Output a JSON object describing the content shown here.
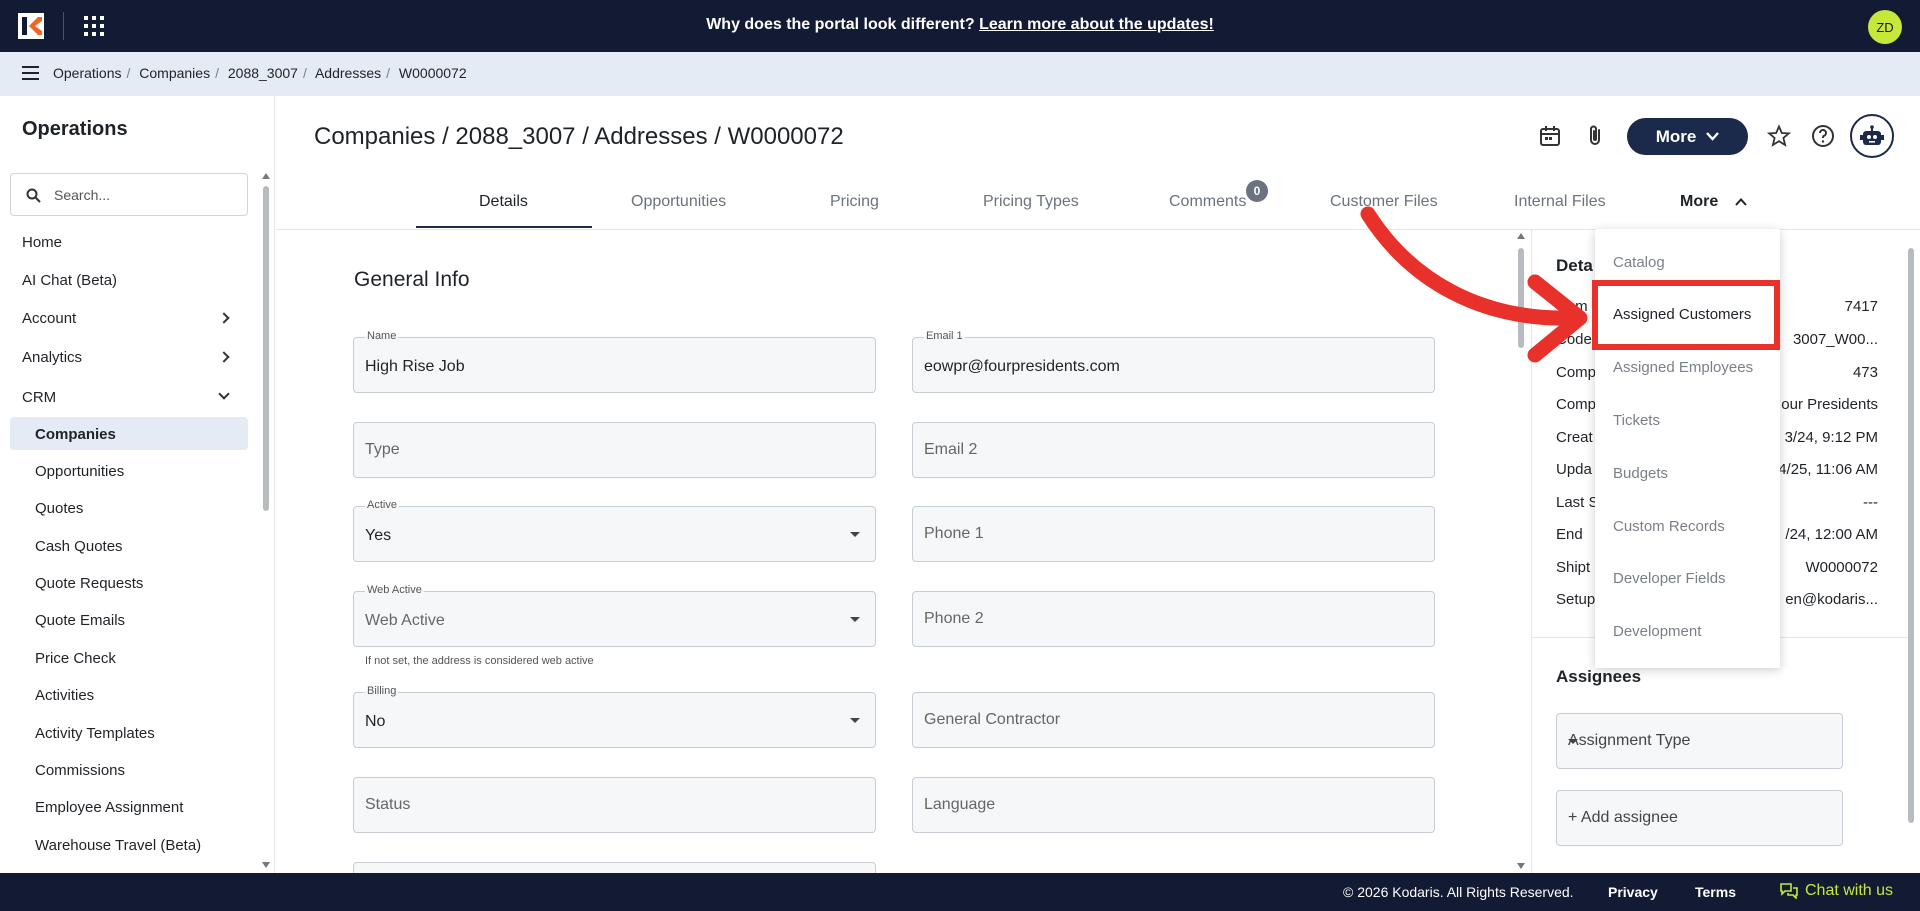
{
  "topbar": {
    "announcement": "Why does the portal look different?",
    "announcement_link": "Learn more about the updates!",
    "avatar_initials": "ZD"
  },
  "breadcrumb": [
    "Operations",
    "Companies",
    "2088_3007",
    "Addresses",
    "W0000072"
  ],
  "sidebar": {
    "title": "Operations",
    "search_placeholder": "Search...",
    "items": [
      {
        "label": "Home"
      },
      {
        "label": "AI Chat (Beta)"
      },
      {
        "label": "Account"
      },
      {
        "label": "Analytics"
      },
      {
        "label": "CRM"
      }
    ],
    "crm_items": [
      {
        "label": "Companies"
      },
      {
        "label": "Opportunities"
      },
      {
        "label": "Quotes"
      },
      {
        "label": "Cash Quotes"
      },
      {
        "label": "Quote Requests"
      },
      {
        "label": "Quote Emails"
      },
      {
        "label": "Price Check"
      },
      {
        "label": "Activities"
      },
      {
        "label": "Activity Templates"
      },
      {
        "label": "Commissions"
      },
      {
        "label": "Employee Assignment"
      },
      {
        "label": "Warehouse Travel (Beta)"
      }
    ]
  },
  "header": {
    "title": "Companies / 2088_3007 / Addresses / W0000072",
    "more_label": "More"
  },
  "tabs": [
    {
      "label": "Details"
    },
    {
      "label": "Opportunities"
    },
    {
      "label": "Pricing"
    },
    {
      "label": "Pricing Types"
    },
    {
      "label": "Comments"
    },
    {
      "label": "Customer Files"
    },
    {
      "label": "Internal Files"
    }
  ],
  "comments_count": "0",
  "tab_more_label": "More",
  "form": {
    "section_title": "General Info",
    "name": {
      "label": "Name",
      "value": "High Rise Job"
    },
    "email1": {
      "label": "Email 1",
      "value": "eowpr@fourpresidents.com"
    },
    "type": {
      "placeholder": "Type"
    },
    "email2": {
      "placeholder": "Email 2"
    },
    "active": {
      "label": "Active",
      "value": "Yes"
    },
    "phone1": {
      "placeholder": "Phone 1"
    },
    "web_active": {
      "label": "Web Active",
      "placeholder": "Web Active",
      "helper": "If not set, the address is considered web active"
    },
    "phone2": {
      "placeholder": "Phone 2"
    },
    "billing": {
      "label": "Billing",
      "value": "No"
    },
    "general_contractor": {
      "placeholder": "General Contractor"
    },
    "status": {
      "placeholder": "Status"
    },
    "language": {
      "placeholder": "Language"
    }
  },
  "details_panel": {
    "title": "Deta",
    "rows": [
      {
        "key": "Com",
        "value": "7417"
      },
      {
        "key": "Code",
        "value": "3007_W00..."
      },
      {
        "key": "Comp",
        "value": "473"
      },
      {
        "key": "Comp",
        "value": "our Presidents"
      },
      {
        "key": "Creat",
        "value": "3/24, 9:12 PM"
      },
      {
        "key": "Upda",
        "value": "4/25, 11:06 AM"
      },
      {
        "key": "Last S",
        "value": "---"
      },
      {
        "key": "End",
        "value": "/24, 12:00 AM"
      },
      {
        "key": "Shipt",
        "value": "W0000072"
      },
      {
        "key": "Setup",
        "value": "en@kodaris..."
      }
    ],
    "assignees_title": "Assignees",
    "assignment_type_placeholder": "Assignment Type",
    "add_assignee": "+ Add assignee"
  },
  "more_menu": [
    {
      "label": "Catalog"
    },
    {
      "label": "Assigned Customers"
    },
    {
      "label": "Assigned Employees"
    },
    {
      "label": "Tickets"
    },
    {
      "label": "Budgets"
    },
    {
      "label": "Custom Records"
    },
    {
      "label": "Developer Fields"
    },
    {
      "label": "Development"
    }
  ],
  "footer": {
    "copyright": "© 2026 Kodaris. All Rights Reserved.",
    "privacy": "Privacy",
    "terms": "Terms",
    "chat": "Chat with us"
  },
  "colors": {
    "navy": "#131a33",
    "accent_lime": "#c6e83a",
    "annotation_red": "#e8312a"
  }
}
